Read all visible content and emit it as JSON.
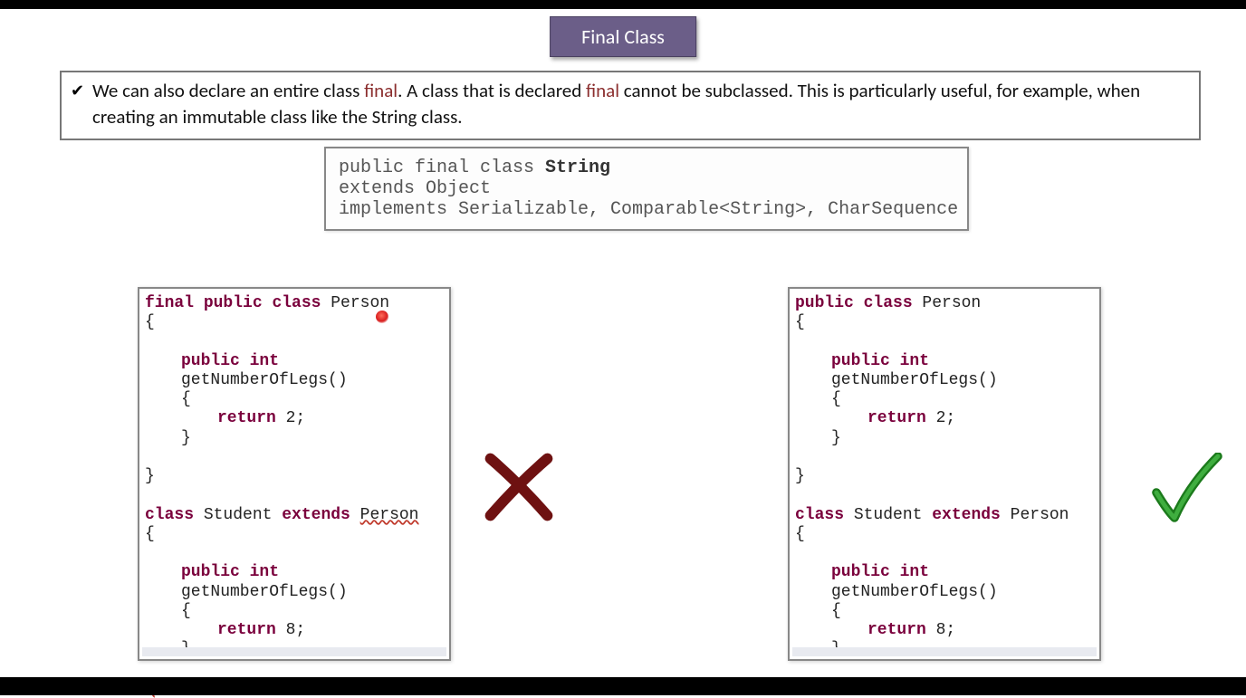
{
  "title": "Final Class",
  "description": {
    "t1": "We can also declare an entire class ",
    "k1": "final",
    "t2": ". A class that is declared ",
    "k2": "final",
    "t3": " cannot be subclassed. This is particularly useful, for example, when creating an immutable class like the String class."
  },
  "string_decl": {
    "line1a": "public final class ",
    "line1b": "String",
    "line2": "extends Object",
    "line3": "implements Serializable, Comparable<String>, CharSequence"
  },
  "left": {
    "l1a": "final",
    "l1b": " public",
    "l1c": " class",
    "l1d": " Person",
    "l2": "{",
    "l3a": "public",
    "l3b": " int",
    "l3c": " getNumberOfLegs()",
    "l4": "{",
    "l5a": "return",
    "l5b": " 2;",
    "l6": "}",
    "l7": "}",
    "l8a": "class",
    "l8b": " Student ",
    "l8c": "extends",
    "l8d": " ",
    "l8e": "Person",
    "l9": "{",
    "l10a": "public",
    "l10b": " int",
    "l10c": " getNumberOfLegs()",
    "l11": "{",
    "l12a": "return",
    "l12b": " 8;",
    "l13": "}",
    "l14": "}"
  },
  "right": {
    "l1a": "public",
    "l1b": " class",
    "l1c": " Person",
    "l2": "{",
    "l3a": "public",
    "l3b": " int",
    "l3c": " getNumberOfLegs()",
    "l4": "{",
    "l5a": "return",
    "l5b": " 2;",
    "l6": "}",
    "l7": "}",
    "l8a": "class",
    "l8b": " Student ",
    "l8c": "extends",
    "l8d": " Person",
    "l9": "{",
    "l10a": "public",
    "l10b": " int",
    "l10c": " getNumberOfLegs()",
    "l11": "{",
    "l12a": "return",
    "l12b": " 8;",
    "l13": "}",
    "l14": "}"
  }
}
